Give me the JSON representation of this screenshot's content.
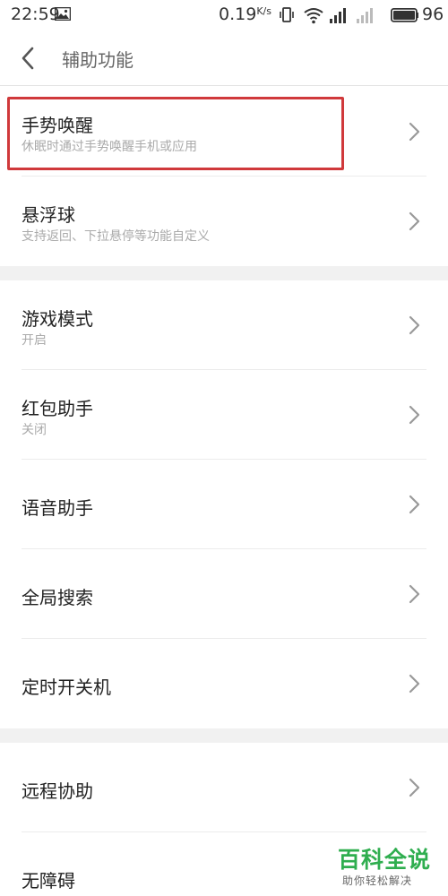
{
  "status_bar": {
    "time": "22:59",
    "net_speed": "0.19",
    "net_speed_unit": "K/s",
    "battery": "96"
  },
  "header": {
    "title": "辅助功能"
  },
  "settings": [
    {
      "title": "手势唤醒",
      "subtitle": "休眠时通过手势唤醒手机或应用"
    },
    {
      "title": "悬浮球",
      "subtitle": "支持返回、下拉悬停等功能自定义"
    },
    {
      "title": "游戏模式",
      "subtitle": "开启"
    },
    {
      "title": "红包助手",
      "subtitle": "关闭"
    },
    {
      "title": "语音助手"
    },
    {
      "title": "全局搜索"
    },
    {
      "title": "定时开关机"
    },
    {
      "title": "远程协助"
    },
    {
      "title": "无障碍"
    }
  ],
  "watermark": {
    "title": "百科全说",
    "subtitle": "助你轻松解决"
  },
  "colors": {
    "highlight": "#d0393b",
    "watermark": "#2fae4f",
    "section_gap": "#f1f1f1"
  }
}
